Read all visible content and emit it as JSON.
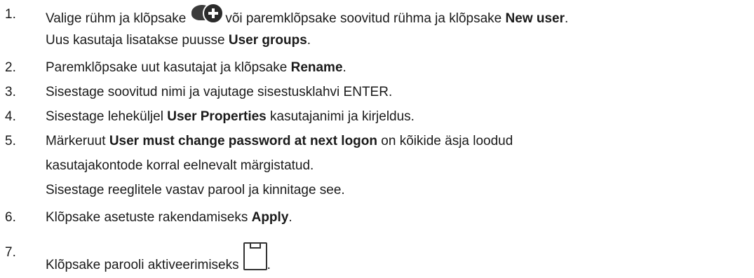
{
  "steps": [
    {
      "number": "1.",
      "line1": {
        "a": "Valige rühm ja klõpsake",
        "b": "või paremklõpsake soovitud rühma ja klõpsake",
        "c": "New user",
        "d": "."
      },
      "line2": {
        "a": "Uus kasutaja lisatakse puusse",
        "b": "User groups",
        "c": "."
      },
      "icon": "new-user-icon"
    },
    {
      "number": "2.",
      "a": "Paremklõpsake uut kasutajat ja klõpsake",
      "b": "Rename",
      "c": "."
    },
    {
      "number": "3.",
      "text": "Sisestage soovitud nimi ja vajutage sisestusklahvi ENTER."
    },
    {
      "number": "4.",
      "a": "Sisestage leheküljel",
      "b": "User Properties",
      "c": "kasutajanimi ja kirjeldus."
    },
    {
      "number": "5.",
      "line1": {
        "a": "Märkeruut",
        "b": "User must change password at next logon",
        "c": "on kõikide äsja loodud"
      },
      "line2": "kasutajakontode korral eelnevalt märgistatud.",
      "line3": "Sisestage reeglitele vastav parool ja kinnitage see."
    },
    {
      "number": "6.",
      "a": "Klõpsake asetuste rakendamiseks",
      "b": "Apply",
      "c": "."
    },
    {
      "number": "7.",
      "a": "Klõpsake parooli aktiveerimiseks",
      "b": ".",
      "icon": "save-icon"
    }
  ]
}
